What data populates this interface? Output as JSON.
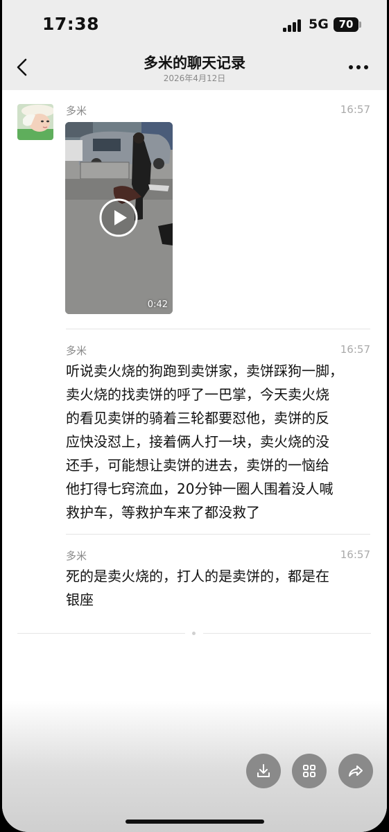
{
  "status_bar": {
    "time": "17:38",
    "network": "5G",
    "battery": "70"
  },
  "nav": {
    "title": "多米的聊天记录",
    "subtitle": "2026年4月12日"
  },
  "messages": [
    {
      "sender": "多米",
      "time": "16:57",
      "type": "video",
      "duration": "0:42"
    },
    {
      "sender": "多米",
      "time": "16:57",
      "type": "text",
      "lines": [
        "听说卖火烧的狗跑到卖饼家，卖饼踩狗一脚，",
        "卖火烧的找卖饼的呼了一巴掌，今天卖火烧",
        "的看见卖饼的骑着三轮都要怼他，卖饼的反",
        "应快没怼上，接着俩人打一块，卖火烧的没",
        "还手，可能想让卖饼的进去，卖饼的一恼给",
        "他打得七窍流血，20分钟一圈人围着没人喊",
        "救护车，等救护车来了都没救了"
      ]
    },
    {
      "sender": "多米",
      "time": "16:57",
      "type": "text",
      "lines": [
        "死的是卖火烧的，打人的是卖饼的，都是在",
        "银座"
      ]
    }
  ],
  "icons": {
    "back": "chevron-left-icon",
    "more": "more-dots-icon",
    "play": "play-icon",
    "download": "download-icon",
    "grid": "grid-icon",
    "share": "share-icon"
  },
  "colors": {
    "header_bg": "#ededed",
    "background": "#ffffff",
    "text": "#111111",
    "meta_text": "#888888",
    "button_bg": "#8a8a8a"
  }
}
